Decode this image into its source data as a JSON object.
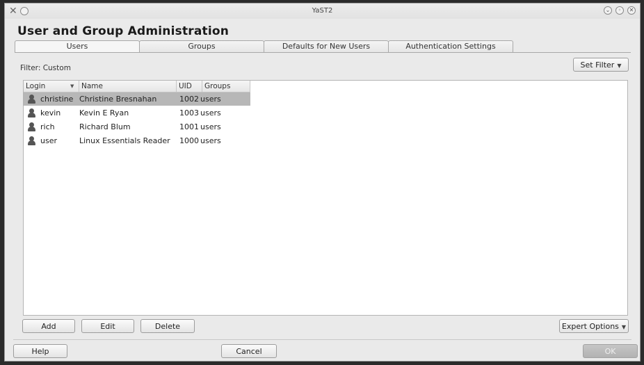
{
  "window": {
    "title": "YaST2"
  },
  "page": {
    "heading": "User and Group Administration"
  },
  "tabs": [
    {
      "label": "Users"
    },
    {
      "label": "Groups"
    },
    {
      "label": "Defaults for New Users"
    },
    {
      "label": "Authentication Settings"
    }
  ],
  "filter": {
    "label": "Filter: Custom",
    "set_filter_label": "Set Filter"
  },
  "table": {
    "columns": [
      "Login",
      "Name",
      "UID",
      "Groups"
    ],
    "rows": [
      {
        "login": "christine",
        "name": "Christine Bresnahan",
        "uid": "1002",
        "groups": "users",
        "selected": true
      },
      {
        "login": "kevin",
        "name": "Kevin E Ryan",
        "uid": "1003",
        "groups": "users",
        "selected": false
      },
      {
        "login": "rich",
        "name": "Richard Blum",
        "uid": "1001",
        "groups": "users",
        "selected": false
      },
      {
        "login": "user",
        "name": "Linux Essentials Reader",
        "uid": "1000",
        "groups": "users",
        "selected": false
      }
    ]
  },
  "actions": {
    "add": "Add",
    "edit": "Edit",
    "delete": "Delete",
    "expert_options": "Expert Options"
  },
  "footer": {
    "help": "Help",
    "cancel": "Cancel",
    "ok": "OK"
  },
  "icons": {
    "app": "yast-app-icon",
    "user": "user-icon",
    "sort": "sort-down-icon"
  }
}
